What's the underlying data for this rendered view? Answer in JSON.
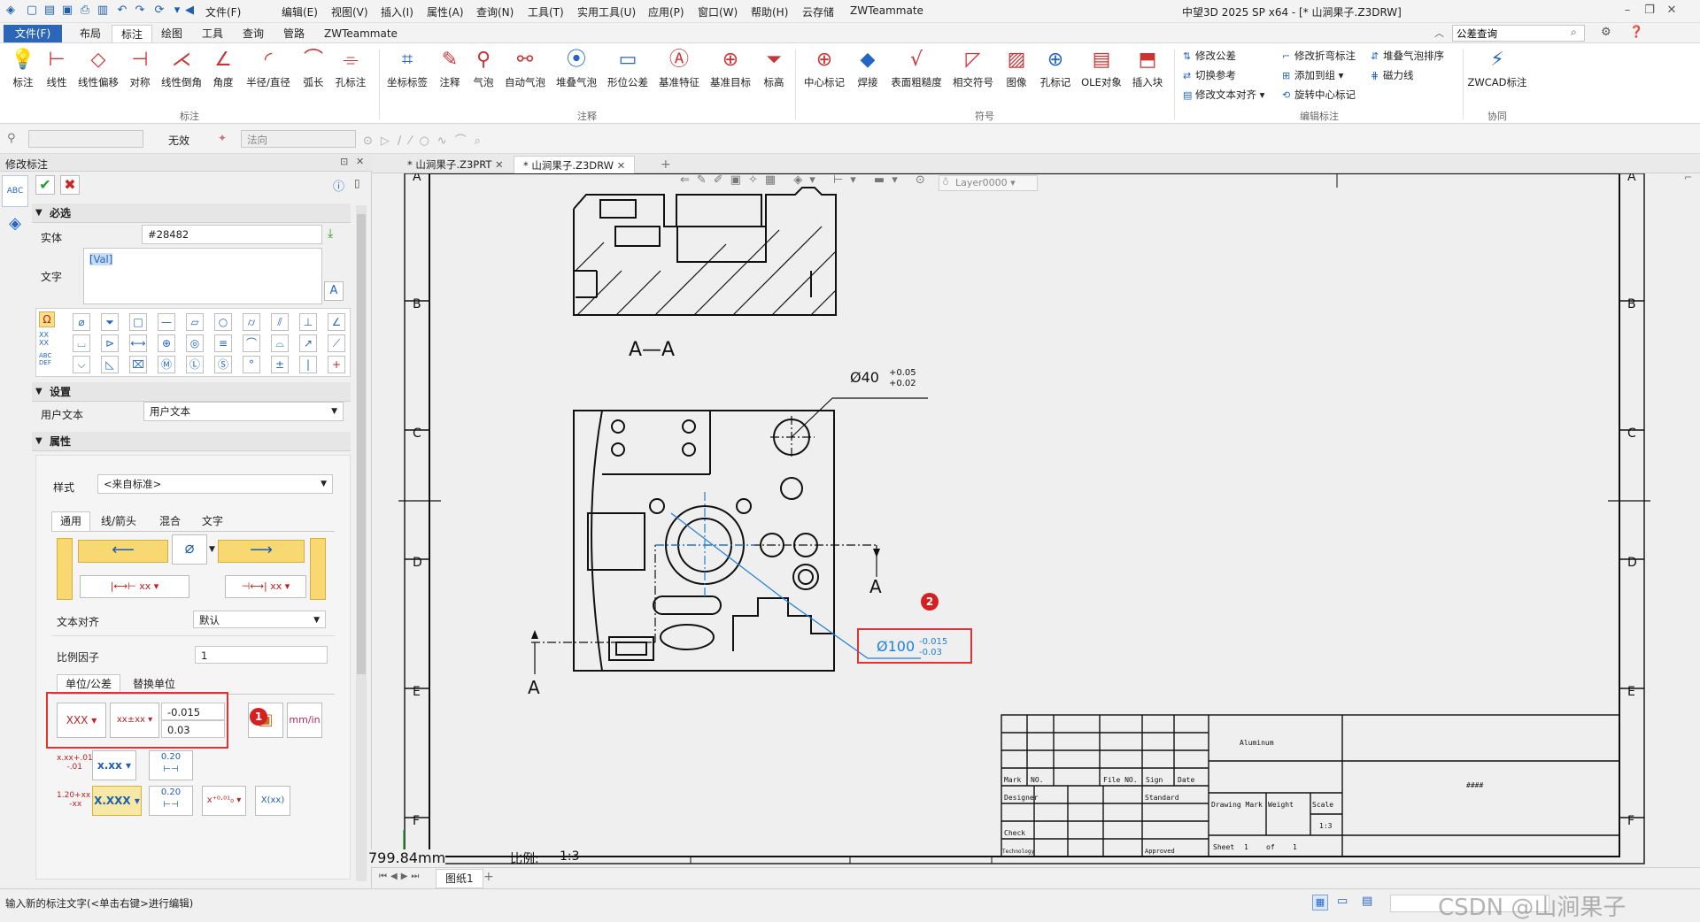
{
  "title": "中望3D 2025 SP x64 - [* 山涧果子.Z3DRW]",
  "menubar": [
    "文件(F)",
    "编辑(E)",
    "视图(V)",
    "插入(I)",
    "属性(A)",
    "查询(N)",
    "工具(T)",
    "实用工具(U)",
    "应用(P)",
    "窗口(W)",
    "帮助(H)",
    "云存储",
    "ZWTeammate"
  ],
  "tabs": [
    "文件(F)",
    "布局",
    "标注",
    "绘图",
    "工具",
    "查询",
    "管路",
    "ZWTeammate"
  ],
  "search_placeholder": "公差查询",
  "ribbon": {
    "annotate": [
      "标注",
      "线性",
      "线性偏移",
      "对称",
      "线性倒角",
      "角度",
      "半径/直径",
      "弧长",
      "孔标注"
    ],
    "annotate_group": "标注",
    "notes": [
      "坐标标签",
      "注释",
      "气泡",
      "自动气泡",
      "堆叠气泡",
      "形位公差",
      "基准特征",
      "基准目标",
      "标高"
    ],
    "notes_group": "注释",
    "symbols": [
      "中心标记",
      "焊接",
      "表面粗糙度",
      "相交符号",
      "图像",
      "孔标记",
      "OLE对象",
      "插入块"
    ],
    "symbols_group": "符号",
    "edit_small": [
      "修改公差",
      "切换参考",
      "修改文本对齐",
      "修改折弯标注",
      "添加到组",
      "旋转中心标记",
      "堆叠气泡排序",
      "磁力线"
    ],
    "edit_group": "编辑标注",
    "zwcad": "ZWCAD标注",
    "collab_group": "协同"
  },
  "propbar": {
    "invalid": "无效",
    "direction": "法向"
  },
  "panel": {
    "title": "修改标注",
    "required": "必选",
    "entity_label": "实体",
    "entity_value": "#28482",
    "text_label": "文字",
    "text_value": "[Val]",
    "settings": "设置",
    "user_text_label": "用户文本",
    "user_text_value": "用户文本",
    "properties": "属性",
    "style_label": "样式",
    "style_value": "<来自标准>",
    "subtabs": [
      "通用",
      "线/箭头",
      "混合",
      "文字"
    ],
    "text_align_label": "文本对齐",
    "text_align_value": "默认",
    "scale_label": "比例因子",
    "scale_value": "1",
    "unit_tabs": [
      "单位/公差",
      "替换单位"
    ],
    "tol_upper": "-0.015",
    "tol_lower": "0.03",
    "fmt1": "XXX",
    "fmt2": "x.xx",
    "fmt3": "X.XXX",
    "fmt_020a": "0.20",
    "fmt_020b": "0.20",
    "fmt_x": "X(xx)",
    "badge": "1"
  },
  "doctabs": [
    "* 山涧果子.Z3PRT",
    "* 山涧果子.Z3DRW"
  ],
  "drawing": {
    "section_label": "A—A",
    "cut_label_left": "A",
    "cut_label_right": "A",
    "dim_top": "Ø40",
    "dim_top_upper": "+0.05",
    "dim_top_lower": "+0.02",
    "dim_sel": "Ø100",
    "dim_sel_upper": "-0.015",
    "dim_sel_lower": "-0.03",
    "badge": "2",
    "rows": [
      "A",
      "B",
      "C",
      "D",
      "E",
      "F"
    ],
    "layer": "Layer0000",
    "length": "799.84mm",
    "scale_label": "比例:",
    "scale_value": "1:3",
    "tb": {
      "material": "Aluminum",
      "mark": "Mark",
      "no": "NO.",
      "fileno": "File NO.",
      "sign": "Sign",
      "date": "Date",
      "designer": "Designer",
      "standard": "Standard",
      "check": "Check",
      "technology": "Technology",
      "approved": "Approved",
      "drawing_mark": "Drawing Mark",
      "weight": "Weight",
      "scale": "Scale",
      "scale_val": "1:3",
      "sheet": "Sheet",
      "sheet_no": "1",
      "of": "of",
      "total": "1",
      "code": "####"
    }
  },
  "sheet_tab": "图纸1",
  "status_text": "输入新的标注文字(<单击右键>进行编辑)",
  "watermark": "CSDN @山涧果子"
}
